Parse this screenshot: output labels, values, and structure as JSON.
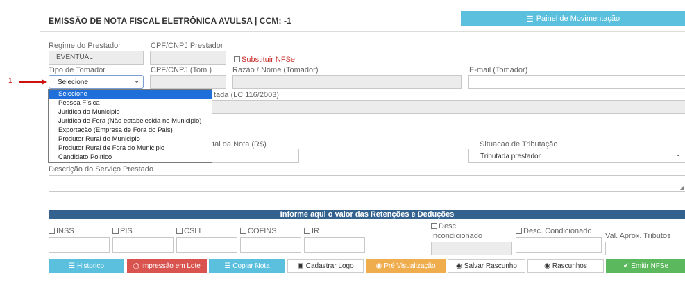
{
  "annotation": {
    "marker": "1"
  },
  "header": {
    "title": "EMISSÃO DE NOTA FISCAL ELETRÔNICA AVULSA | CCM: -1",
    "panel_button": "Painel de Movimentação"
  },
  "prestador": {
    "regime_label": "Regime do Prestador",
    "regime_value": "EVENTUAL",
    "cpf_label": "CPF/CNPJ Prestador",
    "substituir_label": "Substituir NFSe"
  },
  "tomador": {
    "tipo_label": "Tipo de Tomador",
    "tipo_value": "Selecione",
    "cpf_label": "CPF/CNPJ (Tom.)",
    "razao_label": "Razão / Nome (Tomador)",
    "email_label": "E-mail (Tomador)",
    "options": [
      "Selecione",
      "Pessoa Física",
      "Juridica do Municipio",
      "Juridica de Fora (Não estabelecida no Municipio)",
      "Exportação (Empresa de Fora do Pais)",
      "Produtor Rural do Municipio",
      "Produtor Rural de Fora do Municipio",
      "Candidato Político"
    ]
  },
  "servico": {
    "atividade_label_partial": "tada (LC 116/2003)",
    "valor_label_partial": "otal da Nota (R$)",
    "situacao_label": "Situacao de Tributação",
    "situacao_value": "Tributada prestador",
    "descricao_label": "Descrição do Serviço Prestado"
  },
  "retencoes": {
    "bar_title": "Informe aqui o valor das Retenções e Deduções",
    "inss": "INSS",
    "pis": "PIS",
    "csll": "CSLL",
    "cofins": "COFINS",
    "ir": "IR",
    "desc_incond_1": "Desc.",
    "desc_incond_2": "Incondicionado",
    "desc_cond": "Desc. Condicionado",
    "val_aprox": "Val. Aprox. Tributos"
  },
  "buttons": {
    "historico": "Historico",
    "impressao": "Impressão em Lote",
    "copiar": "Copiar Nota",
    "cadastrar_logo": "Cadastrar Logo",
    "pre_visualizacao": "Pré Visualização",
    "salvar_rascunho": "Salvar Rascunho",
    "rascunhos": "Rascunhos",
    "emitir": "Emitir NFSe"
  },
  "colors": {
    "info": "#5bc0de",
    "danger": "#d9534f",
    "warning": "#f0ad4e",
    "success": "#5cb85c",
    "bar": "#34628f",
    "selected_option": "#1e6fd9",
    "annotation_arrow": "#cc1111"
  }
}
